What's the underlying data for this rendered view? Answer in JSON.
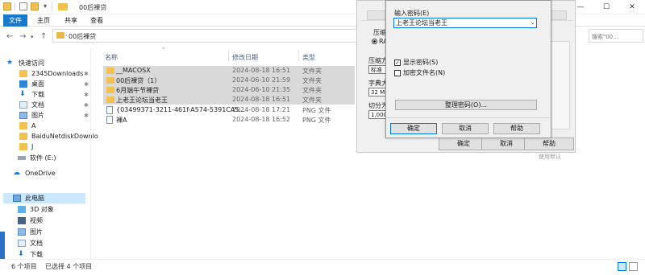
{
  "window": {
    "title": "00后裸贷",
    "controls": {
      "minimize": "—",
      "maximize": "☐",
      "close": "✕"
    }
  },
  "ribbon": {
    "tabs": [
      "文件",
      "主页",
      "共享",
      "查看"
    ]
  },
  "address": {
    "path": "00后裸贷",
    "search_placeholder": "搜索\"00..."
  },
  "sidebar": {
    "items": [
      {
        "label": "快速访问",
        "icon": "star-icon"
      },
      {
        "label": "2345Downloads",
        "icon": "folder-icon",
        "pinned": true
      },
      {
        "label": "桌面",
        "icon": "desktop-icon",
        "pinned": true
      },
      {
        "label": "下载",
        "icon": "download-icon",
        "pinned": true
      },
      {
        "label": "文档",
        "icon": "document-icon",
        "pinned": true
      },
      {
        "label": "图片",
        "icon": "picture-icon",
        "pinned": true
      },
      {
        "label": "A",
        "icon": "folder-icon"
      },
      {
        "label": "BaiduNetdiskDownlo",
        "icon": "folder-icon"
      },
      {
        "label": "J",
        "icon": "folder-icon"
      },
      {
        "label": "软件 (E:)",
        "icon": "drive-icon"
      },
      {
        "label": "OneDrive",
        "icon": "cloud-icon"
      },
      {
        "label": "此电脑",
        "icon": "computer-icon",
        "selected": true
      },
      {
        "label": "3D 对象",
        "icon": "3d-icon"
      },
      {
        "label": "视频",
        "icon": "video-icon"
      },
      {
        "label": "图片",
        "icon": "picture-icon"
      },
      {
        "label": "文档",
        "icon": "document-icon"
      },
      {
        "label": "下载",
        "icon": "download-icon"
      }
    ]
  },
  "columns": {
    "name": "名称",
    "date": "修改日期",
    "type": "类型"
  },
  "files": [
    {
      "name": "__MACOSX",
      "date": "2024-08-18 16:51",
      "type": "文件夹",
      "icon": "folder-icon",
      "selected": true
    },
    {
      "name": "00后裸贷（1）",
      "date": "2024-06-10 21:59",
      "type": "文件夹",
      "icon": "folder-icon",
      "selected": true
    },
    {
      "name": "6月端午节裸贷",
      "date": "2024-06-10 21:35",
      "type": "文件夹",
      "icon": "folder-icon",
      "selected": true
    },
    {
      "name": "上老王论坛当老王",
      "date": "2024-08-18 16:51",
      "type": "文件夹",
      "icon": "folder-icon",
      "selected": true
    },
    {
      "name": "{03499371-3211-461f-A574-5391CA5...",
      "date": "2024-08-18 17:21",
      "type": "PNG 文件",
      "icon": "image-file-icon",
      "selected": false
    },
    {
      "name": "裸A",
      "date": "2024-08-18 16:52",
      "type": "PNG 文件",
      "icon": "image-file-icon",
      "selected": false
    }
  ],
  "status": {
    "count": "6 个项目",
    "selected": "已选择 4 个项目"
  },
  "compress_dialog": {
    "labels": {
      "compress_mode": "压缩",
      "compress_radio": "RA",
      "method": "压缩方",
      "method_value": "标准",
      "dict": "字典大",
      "dict_value": "32 MB",
      "split": "切分为",
      "split_value": "1,000"
    },
    "buttons": {
      "ok": "确定",
      "cancel": "取消",
      "help": "帮助"
    }
  },
  "password_dialog": {
    "prompt": "输入密码(E)",
    "password_value": "上老王论坛当老王",
    "options": [
      {
        "label": "显示密码(S)",
        "checked": true
      },
      {
        "label": "加密文件名(N)",
        "checked": false
      }
    ],
    "organize_button": "整理密码(O)...",
    "buttons": {
      "ok": "确定",
      "cancel": "取消",
      "help": "帮助"
    }
  },
  "watermark": "使用默认"
}
